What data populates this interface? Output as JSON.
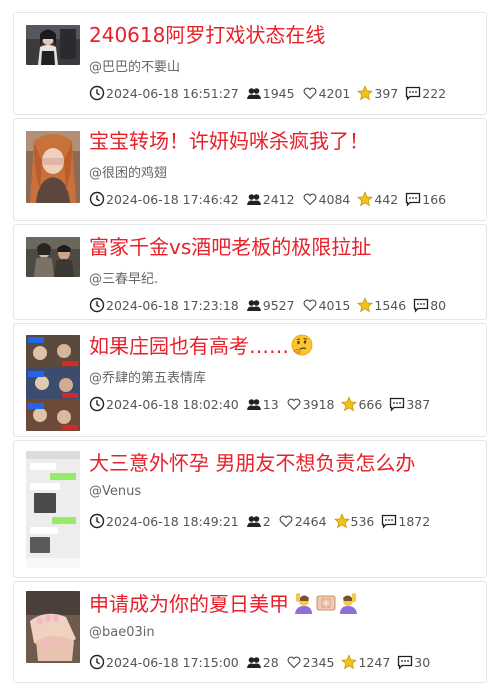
{
  "posts": [
    {
      "title": "240618阿罗打戏状态在线",
      "author": "@巴巴的不要山",
      "time": "2024-06-18 16:51:27",
      "viewers": "1945",
      "likes": "4201",
      "favorites": "397",
      "comments": "222",
      "thumbnail": "woman-in-dark-outfit-photo"
    },
    {
      "title": "宝宝转场！许妍妈咪杀疯我了！",
      "author": "@很困的鸡翅",
      "time": "2024-06-18 17:46:42",
      "viewers": "2412",
      "likes": "4084",
      "favorites": "442",
      "comments": "166",
      "thumbnail": "woman-orange-hair-photo"
    },
    {
      "title": "富家千金vs酒吧老板的极限拉扯",
      "author": "@三春早纪.",
      "time": "2024-06-18 17:23:18",
      "viewers": "9527",
      "likes": "4015",
      "favorites": "1546",
      "comments": "80",
      "thumbnail": "drama-scene-photo"
    },
    {
      "title": "如果庄园也有高考……",
      "title_emoji": "thinking-face-emoji",
      "author": "@乔肆的第五表情库",
      "time": "2024-06-18 18:02:40",
      "viewers": "13",
      "likes": "3918",
      "favorites": "666",
      "comments": "387",
      "thumbnail": "game-character-collage"
    },
    {
      "title": "大三意外怀孕 男朋友不想负责怎么办",
      "author": "@Venus",
      "time": "2024-06-18 18:49:21",
      "viewers": "2",
      "likes": "2464",
      "favorites": "536",
      "comments": "1872",
      "thumbnail": "chat-screenshot"
    },
    {
      "title": "申请成为你的夏日美甲",
      "title_emoji": "raising-hand-bandage-emojis",
      "author": "@bae03in",
      "time": "2024-06-18 17:15:00",
      "viewers": "28",
      "likes": "2345",
      "favorites": "1247",
      "comments": "30",
      "thumbnail": "manicure-hands-photo"
    }
  ],
  "colors": {
    "title": "#e8202a",
    "star": "#f2c21a"
  }
}
